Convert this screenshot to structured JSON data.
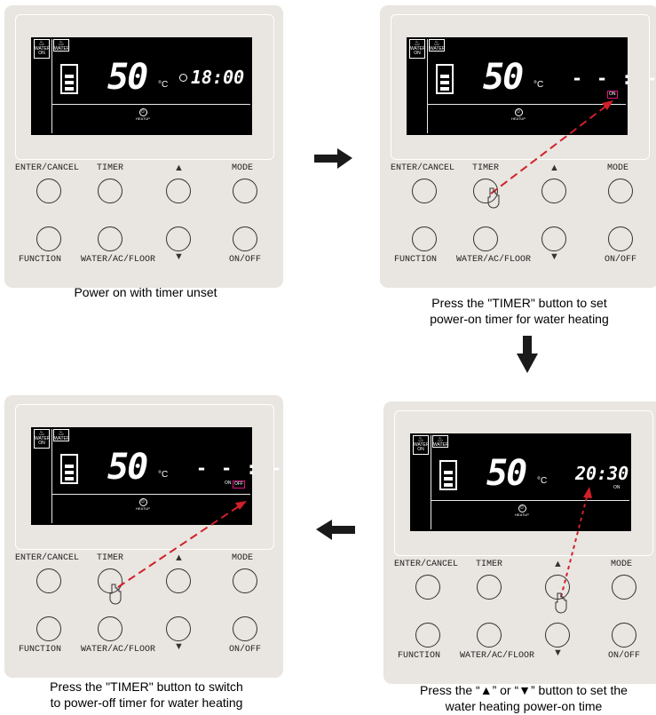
{
  "buttons": {
    "enter_cancel": "ENTER/CANCEL",
    "timer": "TIMER",
    "mode": "MODE",
    "function": "FUNCTION",
    "water_ac_floor": "WATER/AC/FLOOR",
    "on_off": "ON/OFF",
    "up": "▲",
    "down": "▼"
  },
  "lcd": {
    "temp": "50",
    "unit": "°C",
    "icon_water": "WATER",
    "icon_on": "ON",
    "heatup": "HEATUP",
    "on_flag": "ON",
    "off_flag": "OFF",
    "dashes": "- - : - -"
  },
  "panels": [
    {
      "time": "18:00",
      "caption": "Power on with timer unset"
    },
    {
      "time": "",
      "caption_l1": "Press the \"TIMER\" button to set",
      "caption_l2": "power-on timer for water heating"
    },
    {
      "time": "20:30",
      "caption_l1": "Press the “▲” or “▼” button to set the",
      "caption_l2": "water heating power-on time"
    },
    {
      "time": "",
      "caption_l1": "Press the \"TIMER\" button to switch",
      "caption_l2": "to power-off timer for water heating"
    }
  ],
  "colors": {
    "panel": "#e9e5e0",
    "lcd": "#000000",
    "pointer": "#d0202a",
    "highlight": "#d9157f"
  },
  "icons": {
    "arrow_right": "black-arrow-right-icon",
    "arrow_down": "black-arrow-down-icon",
    "arrow_left": "black-arrow-left-icon",
    "hand": "pointing-hand-icon"
  }
}
